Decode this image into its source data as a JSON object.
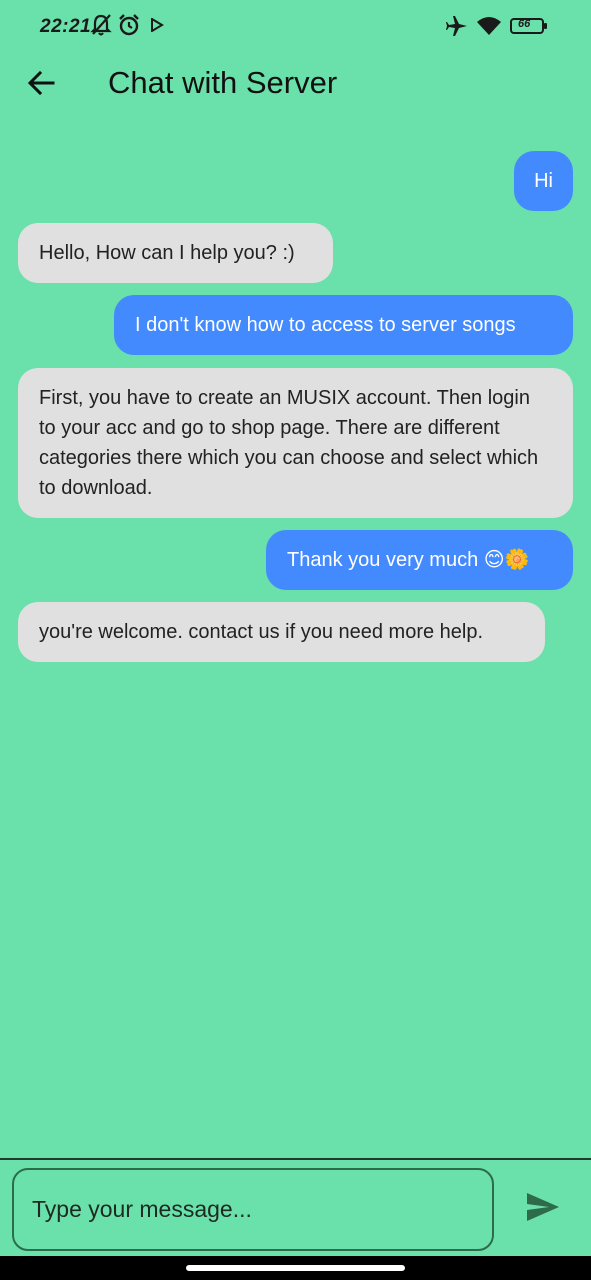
{
  "status_bar": {
    "time": "22:21",
    "battery": "66",
    "icons_left": [
      "bell-off-icon",
      "alarm-icon",
      "play-icon"
    ],
    "icons_right": [
      "airplane-icon",
      "wifi-icon",
      "battery-icon"
    ]
  },
  "app_bar": {
    "title": "Chat with Server",
    "back_icon": "arrow-left-icon"
  },
  "messages": [
    {
      "sender": "user",
      "text": "Hi"
    },
    {
      "sender": "server",
      "text": "Hello, How can I help you? :)"
    },
    {
      "sender": "user",
      "text": "I don't know how to access to server songs"
    },
    {
      "sender": "server",
      "text": "First, you have to create an MUSIX account. Then login to your acc and go to shop page. There are different categories there which you can choose and select which to download."
    },
    {
      "sender": "user",
      "text": "Thank you very much 😊🌼"
    },
    {
      "sender": "server",
      "text": "you're welcome. contact us if you need more help."
    }
  ],
  "composer": {
    "placeholder": "Type your message...",
    "value": "",
    "send_icon": "send-icon"
  },
  "colors": {
    "background": "#6ae0aa",
    "user_bubble": "#448aff",
    "server_bubble": "#e0e0e0",
    "input_border": "#2e6b4a",
    "send_icon": "#2e6b4a"
  }
}
